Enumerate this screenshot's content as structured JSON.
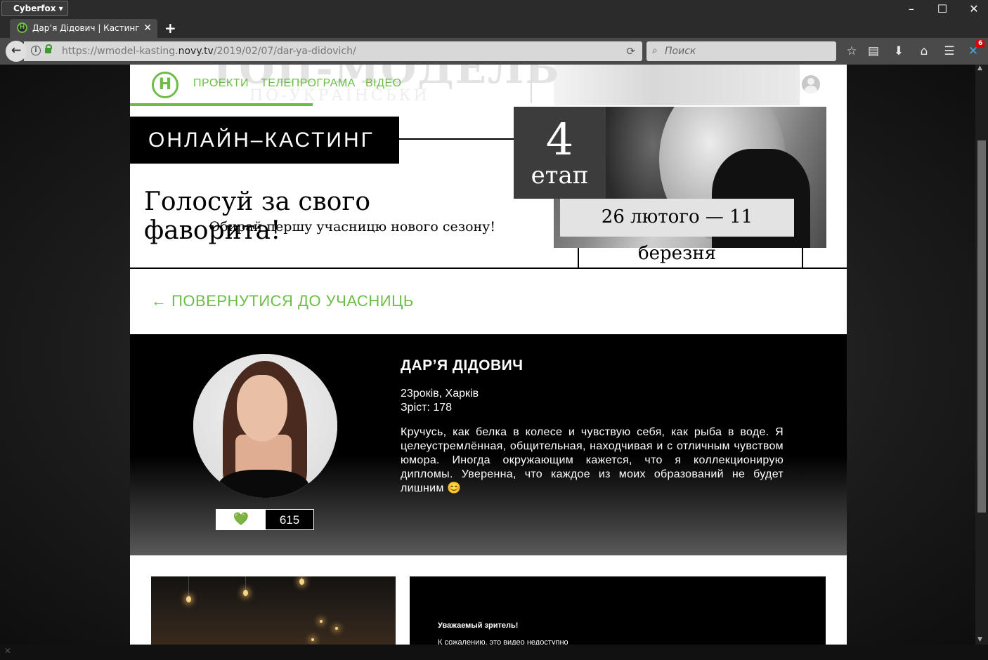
{
  "browser": {
    "app_menu": "Cyberfox",
    "tab_title": "Дар’я Дідович | Кастинг",
    "url_prefix": "https://wmodel-kasting.",
    "url_domain": "novy.tv",
    "url_path": "/2019/02/07/dar-ya-didovich/",
    "search_placeholder": "Поиск",
    "badge_count": "6"
  },
  "site": {
    "logo_letter": "Н",
    "header_bg_text": "ТОП-МОДЕЛЬ",
    "header_bg_sub": "ПО-УКРАЇНСЬКИ",
    "nav": [
      "ПРОЕКТИ",
      "ТЕЛЕПРОГРАМА",
      "ВІДЕО"
    ],
    "accent_color": "#6cbd45"
  },
  "banner": {
    "label": "ОНЛАЙН–КАСТИНГ",
    "headline": "Голосуй за свого фаворита!",
    "subline": "Обирай першу учасницю нового сезону!",
    "stage_number": "4",
    "stage_label": "етап",
    "dates": "26 лютого — 11 березня"
  },
  "back_link": "← ПОВЕРНУТИСЯ ДО УЧАСНИЦЬ",
  "profile": {
    "name": "ДАР’Я ДІДОВИЧ",
    "age_city": "23років, Харків",
    "height": "Зріст: 178",
    "bio": "Кручусь, как белка в колесе и чувствую себя, как рыба в воде. Я целеустремлённая, общительная, находчивая и с отличным чувством юмора. Иногда окружающим кажется, что я коллекционирую дипломы. Уверенна, что каждое из моих образований не будет лишним 😊",
    "vote_icon": "💚",
    "votes": "615"
  },
  "video": {
    "title": "Уважаемый зритель!",
    "message": "К сожалению, это видео недоступно"
  }
}
